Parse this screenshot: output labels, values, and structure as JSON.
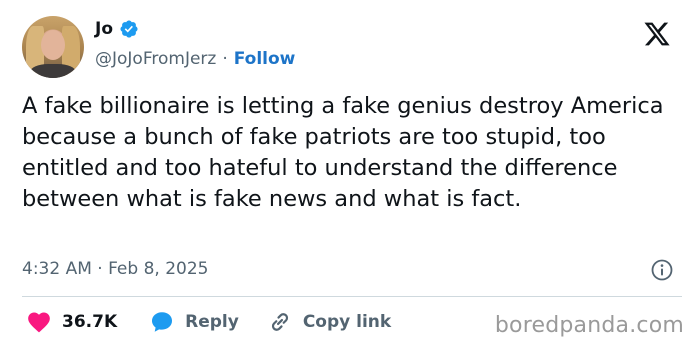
{
  "author": {
    "name": "Jo",
    "handle": "@JoJoFromJerz",
    "separator": "·",
    "follow_label": "Follow"
  },
  "tweet": {
    "text": "A fake billionaire is letting a fake genius destroy America because a bunch of fake patriots are too stupid, too entitled and too hateful to understand the difference between what is fake news and what is fact.",
    "timestamp": "4:32 AM · Feb 8, 2025"
  },
  "actions": {
    "likes": "36.7K",
    "reply_label": "Reply",
    "copy_link_label": "Copy link"
  },
  "watermark": "boredpanda.com",
  "icons": {
    "verified": "verified-badge-icon",
    "platform": "x-logo-icon",
    "info": "info-icon",
    "like": "heart-icon",
    "reply": "speech-bubble-icon",
    "link": "link-icon"
  },
  "colors": {
    "text": "#0f1419",
    "secondary": "#536471",
    "accent": "#1d74c8",
    "like": "#f91880",
    "reply": "#1d9bf0",
    "verified": "#1d9bf0",
    "divider": "#cfd9de"
  }
}
